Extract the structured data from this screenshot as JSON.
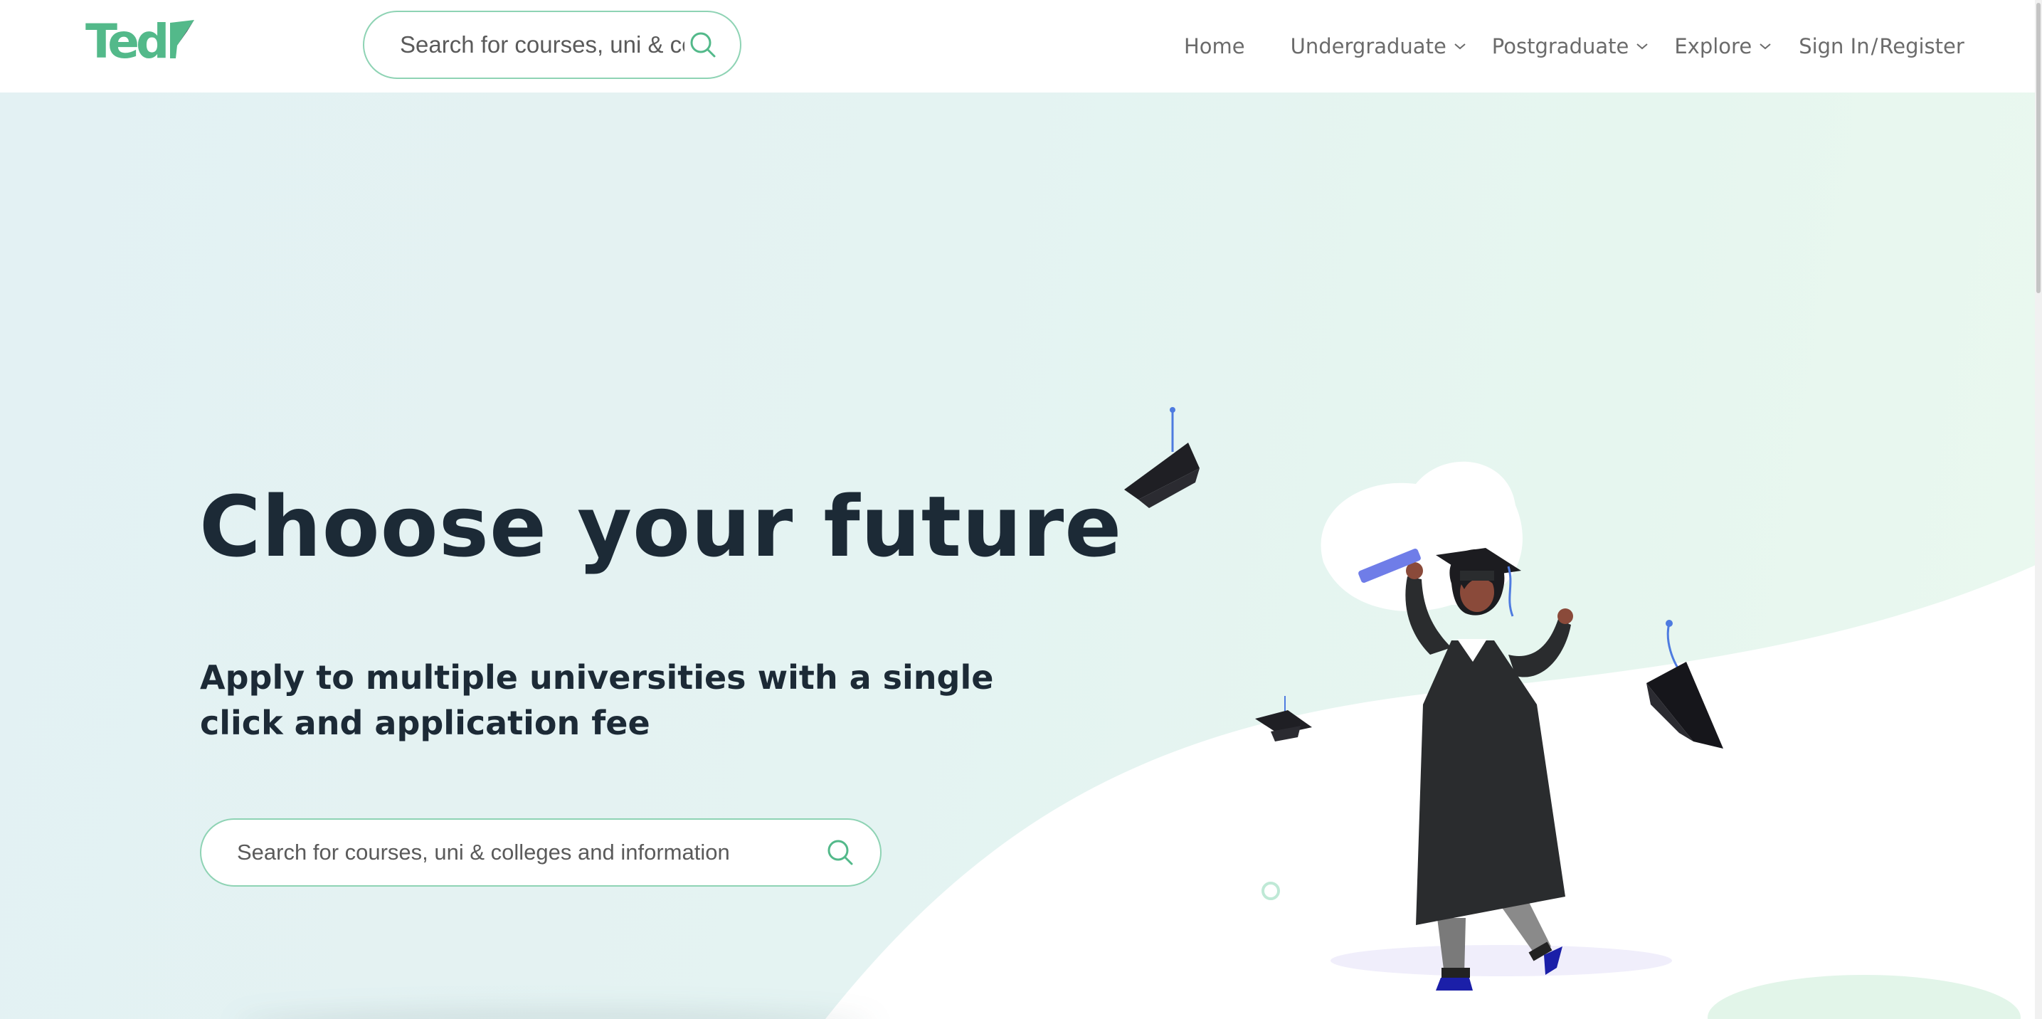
{
  "header": {
    "logo_text": "Ted",
    "search": {
      "placeholder": "Search for courses, uni & colleges and information"
    },
    "nav": {
      "home": "Home",
      "undergraduate": "Undergraduate",
      "postgraduate": "Postgraduate",
      "explore": "Explore",
      "sign_in": "Sign In",
      "separator": "/",
      "register": "Register"
    }
  },
  "hero": {
    "title": "Choose your future",
    "subtitle": "Apply to multiple universities with a single click and application fee",
    "search": {
      "placeholder": "Search for courses, uni & colleges and information"
    }
  },
  "icons": {
    "search": "search-icon",
    "chevron": "chevron-down-icon"
  },
  "colors": {
    "brand_green": "#53b98a",
    "search_border": "#8ed3b4",
    "heading": "#1c2a36",
    "nav_text": "#6b6b6b",
    "hero_bg": "#e4f3f2"
  }
}
